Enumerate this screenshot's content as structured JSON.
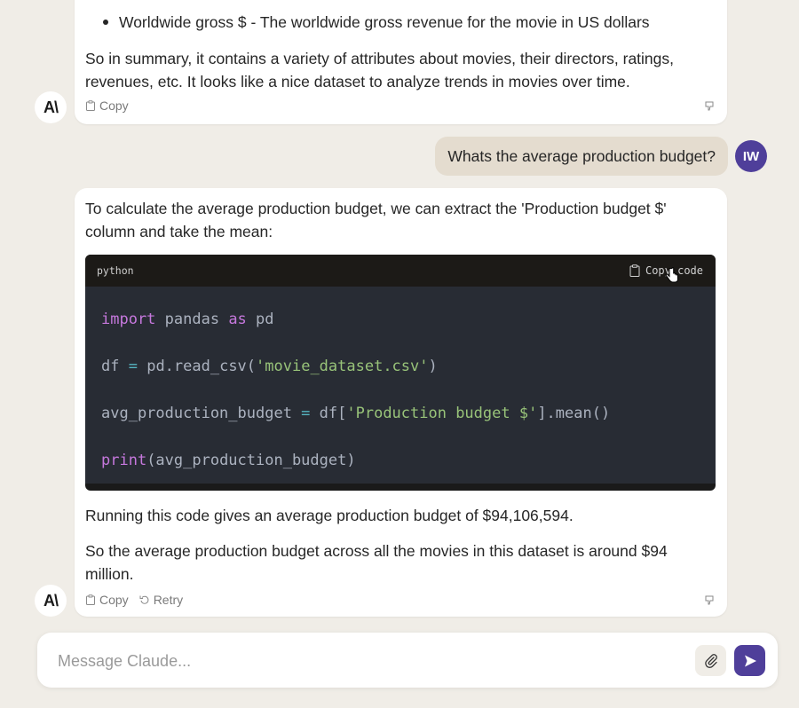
{
  "conversation": {
    "message1": {
      "bullet": "Worldwide gross $ - The worldwide gross revenue for the movie in US dollars",
      "summary": "So in summary, it contains a variety of attributes about movies, their directors, ratings, revenues, etc. It looks like a nice dataset to analyze trends in movies over time.",
      "actions": {
        "copy": "Copy"
      }
    },
    "user_message": {
      "text": "Whats the average production budget?",
      "avatar_initials": "IW"
    },
    "message2": {
      "intro": "To calculate the average production budget, we can extract the 'Production budget $' column and take the mean:",
      "code": {
        "language": "python",
        "copy_label": "Copy code",
        "lines": {
          "l1": {
            "kw1": "import",
            "t1": " pandas ",
            "kw2": "as",
            "t2": " pd"
          },
          "l2": {
            "t1": "df ",
            "op": "=",
            "t2": " pd.read_csv(",
            "str": "'movie_dataset.csv'",
            "t3": ")"
          },
          "l3": {
            "t1": "avg_production_budget ",
            "op": "=",
            "t2": " df[",
            "str": "'Production budget $'",
            "t3": "].mean()"
          },
          "l4": {
            "kw": "print",
            "t1": "(avg_production_budget)"
          }
        }
      },
      "result": "Running this code gives an average production budget of $94,106,594.",
      "conclusion": "So the average production budget across all the movies in this dataset is around $94 million.",
      "actions": {
        "copy": "Copy",
        "retry": "Retry"
      }
    },
    "ai_avatar_label": "A\\"
  },
  "composer": {
    "placeholder": "Message Claude...",
    "value": ""
  },
  "colors": {
    "accent": "#4f3f9a",
    "background": "#f0ede7",
    "user_bubble": "#e4dccf"
  }
}
